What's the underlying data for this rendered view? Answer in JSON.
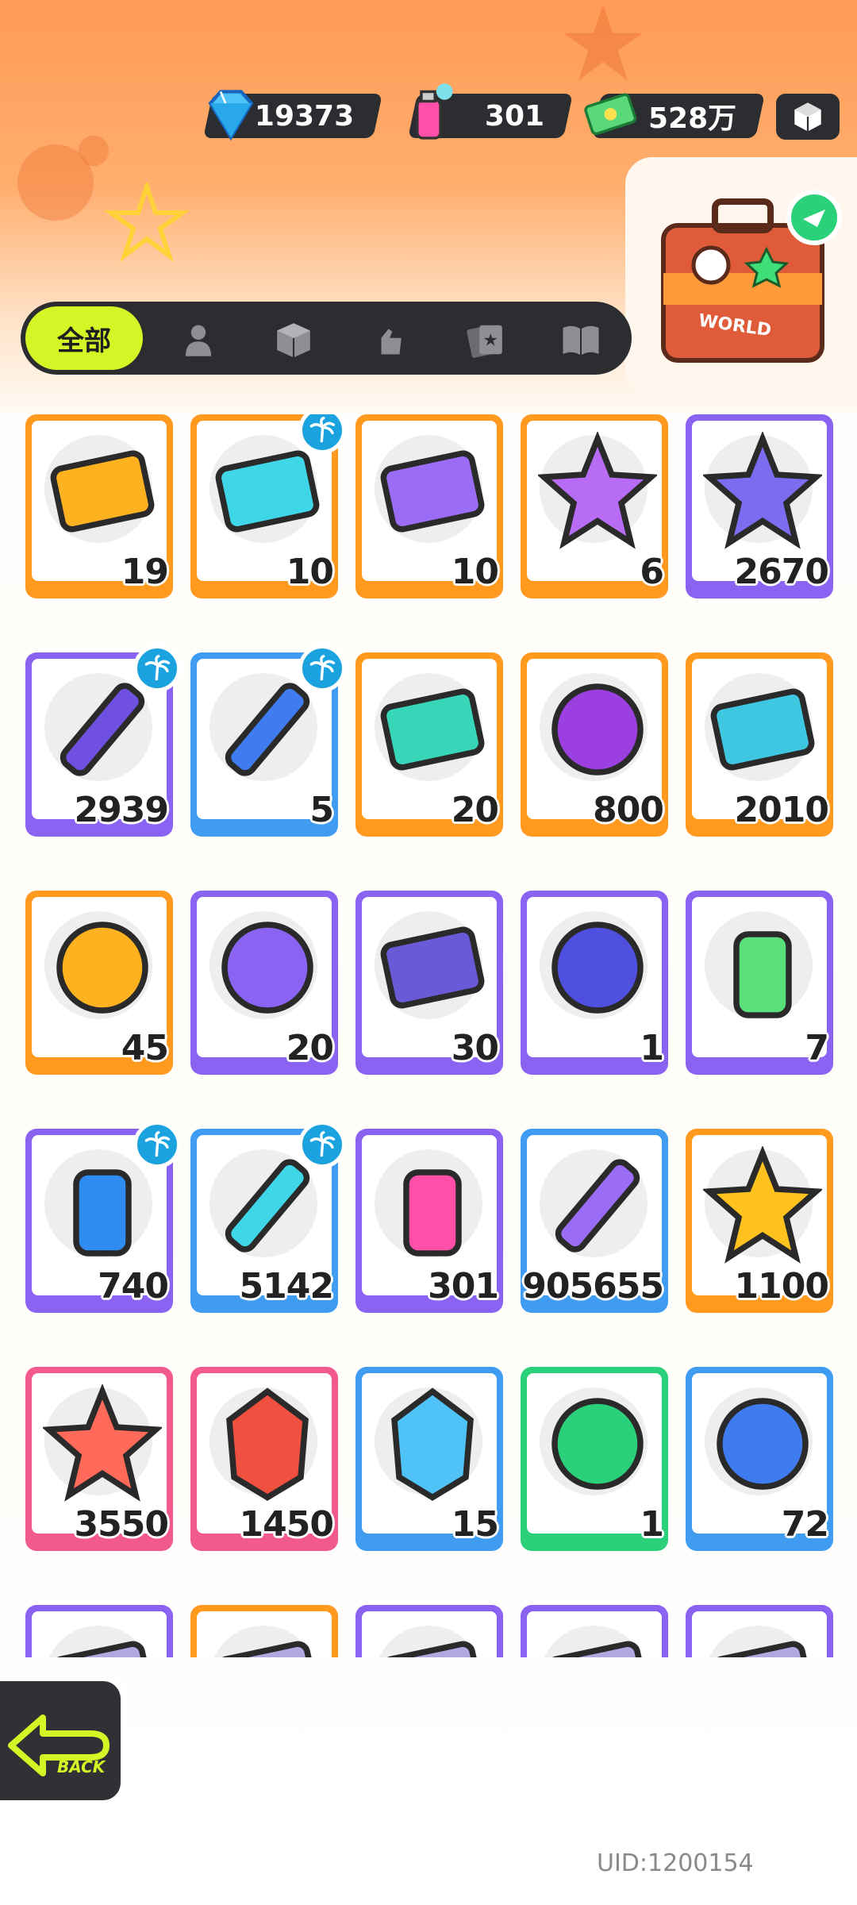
{
  "currencies": [
    {
      "icon": "diamond-icon",
      "value": "19373"
    },
    {
      "icon": "spray-can-icon",
      "value": "301"
    },
    {
      "icon": "cash-icon",
      "value": "528万"
    }
  ],
  "suitcase": {
    "label": "WORLD"
  },
  "tabs": {
    "active_label": "全部",
    "items": [
      "person-icon",
      "box-icon",
      "hand-icon",
      "cards-icon",
      "book-icon"
    ]
  },
  "grid": {
    "rows": [
      [
        {
          "icon": "gold-ticket-icon",
          "count": "19",
          "border": "#ff9a1f",
          "badge": false
        },
        {
          "icon": "wave-up-ticket-icon",
          "count": "10",
          "border": "#ff9a1f",
          "badge": true
        },
        {
          "icon": "purple-ticket-icon",
          "count": "10",
          "border": "#ff9a1f",
          "badge": false
        },
        {
          "icon": "rainbow-star-icon",
          "count": "6",
          "border": "#ff9a1f",
          "badge": false
        },
        {
          "icon": "purple-star-icon",
          "count": "2670",
          "border": "#8a63f2",
          "badge": false
        }
      ],
      [
        {
          "icon": "purple-crayon-icon",
          "count": "2939",
          "border": "#8a63f2",
          "badge": true
        },
        {
          "icon": "blue-crayon-icon",
          "count": "5",
          "border": "#3f9cf0",
          "badge": true
        },
        {
          "icon": "color-cube-icon",
          "count": "20",
          "border": "#ff9a1f",
          "badge": false
        },
        {
          "icon": "cool-badge-icon",
          "count": "800",
          "border": "#ff9a1f",
          "badge": false
        },
        {
          "icon": "season-ticket-icon",
          "count": "2010",
          "border": "#ff9a1f",
          "badge": false
        }
      ],
      [
        {
          "icon": "gold-mystery-badge-icon",
          "count": "45",
          "border": "#ff9a1f",
          "badge": false
        },
        {
          "icon": "purple-mystery-badge-icon",
          "count": "20",
          "border": "#8a63f2",
          "badge": false
        },
        {
          "icon": "mystery-travel-card-icon",
          "count": "30",
          "border": "#8a63f2",
          "badge": false
        },
        {
          "icon": "piranha-coin-icon",
          "count": "1",
          "border": "#8a63f2",
          "badge": false
        },
        {
          "icon": "green-cup-icon",
          "count": "7",
          "border": "#8a63f2",
          "badge": false
        }
      ],
      [
        {
          "icon": "blue-spray-can-icon",
          "count": "740",
          "border": "#8a63f2",
          "badge": true
        },
        {
          "icon": "paint-tube-icon",
          "count": "5142",
          "border": "#3f9cf0",
          "badge": true
        },
        {
          "icon": "pink-spray-can-icon",
          "count": "301",
          "border": "#8a63f2",
          "badge": false
        },
        {
          "icon": "rainbow-paint-tube-icon",
          "count": "905655",
          "border": "#3f9cf0",
          "badge": false
        },
        {
          "icon": "gold-crystal-icon",
          "count": "1100",
          "border": "#ff9a1f",
          "badge": false
        }
      ],
      [
        {
          "icon": "red-crystal-icon",
          "count": "3550",
          "border": "#f25a8d",
          "badge": false
        },
        {
          "icon": "red-gem-icon",
          "count": "1450",
          "border": "#f25a8d",
          "badge": false
        },
        {
          "icon": "blue-flame-icon",
          "count": "15",
          "border": "#3f9cf0",
          "badge": false
        },
        {
          "icon": "green-film-roll-icon",
          "count": "1",
          "border": "#2bd07a",
          "badge": false
        },
        {
          "icon": "blue-film-roll-icon",
          "count": "72",
          "border": "#3f9cf0",
          "badge": false
        }
      ],
      [
        {
          "icon": "partial-card-icon",
          "count": "",
          "border": "#8a63f2",
          "badge": false
        },
        {
          "icon": "partial-card-icon",
          "count": "",
          "border": "#ff9a1f",
          "badge": false
        },
        {
          "icon": "partial-card-icon",
          "count": "",
          "border": "#8a63f2",
          "badge": false
        },
        {
          "icon": "partial-card-icon",
          "count": "",
          "border": "#8a63f2",
          "badge": false
        },
        {
          "icon": "partial-card-icon",
          "count": "",
          "border": "#8a63f2",
          "badge": false
        }
      ]
    ]
  },
  "back": {
    "label": "BACK"
  },
  "uid": "UID:1200154"
}
